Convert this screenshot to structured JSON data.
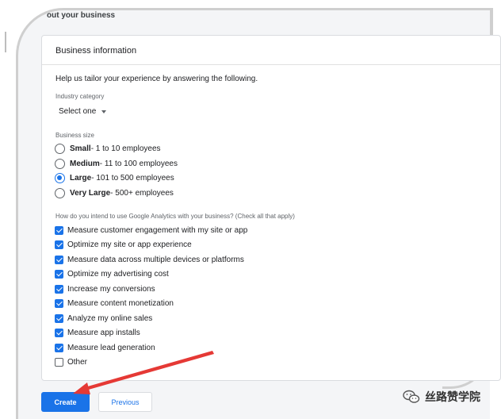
{
  "section": {
    "title": "out your business"
  },
  "card": {
    "header": "Business information",
    "intro": "Help us tailor your experience by answering the following.",
    "industry": {
      "label": "Industry category",
      "value": "Select one"
    },
    "size": {
      "label": "Business size",
      "options": [
        {
          "name": "Small",
          "desc": " - 1 to 10 employees",
          "selected": false
        },
        {
          "name": "Medium",
          "desc": " - 11 to 100 employees",
          "selected": false
        },
        {
          "name": "Large",
          "desc": " - 101 to 500 employees",
          "selected": true
        },
        {
          "name": "Very Large",
          "desc": " - 500+ employees",
          "selected": false
        }
      ]
    },
    "usage": {
      "label": "How do you intend to use Google Analytics with your business? (Check all that apply)",
      "options": [
        {
          "label": "Measure customer engagement with my site or app",
          "checked": true
        },
        {
          "label": "Optimize my site or app experience",
          "checked": true
        },
        {
          "label": "Measure data across multiple devices or platforms",
          "checked": true
        },
        {
          "label": "Optimize my advertising cost",
          "checked": true
        },
        {
          "label": "Increase my conversions",
          "checked": true
        },
        {
          "label": "Measure content monetization",
          "checked": true
        },
        {
          "label": "Analyze my online sales",
          "checked": true
        },
        {
          "label": "Measure app installs",
          "checked": true
        },
        {
          "label": "Measure lead generation",
          "checked": true
        },
        {
          "label": "Other",
          "checked": false
        }
      ]
    }
  },
  "buttons": {
    "create": "Create",
    "previous": "Previous"
  },
  "watermark": {
    "text": "丝路赞学院",
    "icon": "wechat-icon"
  },
  "colors": {
    "accent": "#1a73e8",
    "annotation": "#e53935"
  }
}
